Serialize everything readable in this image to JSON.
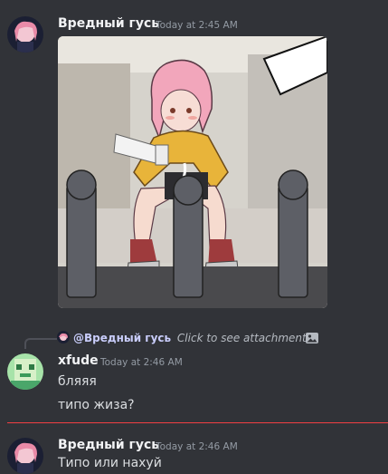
{
  "messages": [
    {
      "author": "Вредный гусь",
      "timestamp": "Today at 2:45 AM",
      "attachment_icon": "anime-image-attachment"
    },
    {
      "reply": {
        "author": "@Вредный гусь",
        "text": "Click to see attachment",
        "icon": "image-icon"
      },
      "author": "xfude",
      "timestamp": "Today at 2:46 AM",
      "lines": [
        "бляяя",
        "типо жиза?"
      ]
    },
    {
      "author": "Вредный гусь",
      "timestamp": "Today at 2:46 AM",
      "lines": [
        "Типо или нахуй"
      ]
    }
  ],
  "colors": {
    "background": "#313338",
    "new_messages_divider": "#f23f43",
    "author_name": "#f2f3f5",
    "timestamp": "#949ba4",
    "text": "#dbdee1"
  }
}
